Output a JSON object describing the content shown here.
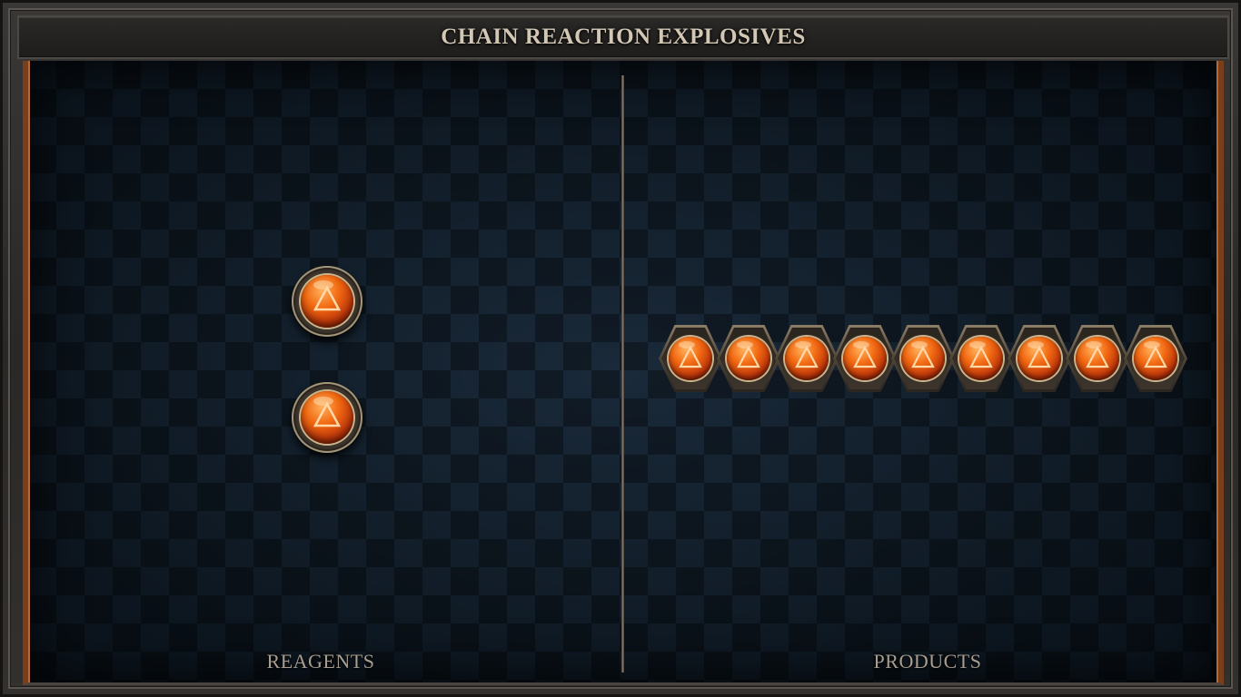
{
  "title": "CHAIN REACTION EXPLOSIVES",
  "reagents": {
    "label": "REAGENTS",
    "items": [
      {
        "icon": "fire-element-icon"
      },
      {
        "icon": "fire-element-icon"
      }
    ]
  },
  "products": {
    "label": "PRODUCTS",
    "chain_length": 9,
    "icon": "fire-element-icon"
  },
  "colors": {
    "orb": "#f26a12",
    "frame_accent": "#b36a35",
    "board": "#0f1a25",
    "title_text": "#d2c7b5"
  }
}
